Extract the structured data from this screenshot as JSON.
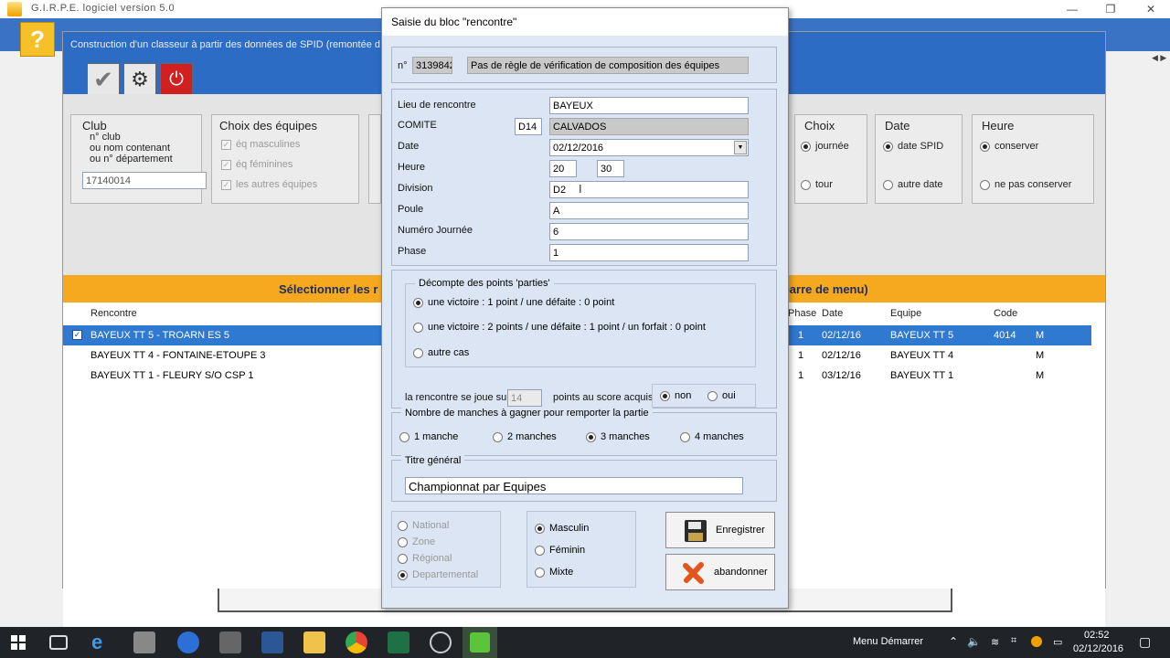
{
  "app": {
    "title": "G.I.R.P.E.  logiciel version  5.0",
    "min": "—",
    "max": "❐",
    "close": "✕",
    "help": "?"
  },
  "builder": {
    "title": "Construction d'un classeur à partir des données de SPID (remontée d",
    "toolbar": {
      "validate": "✔",
      "settings": "⚙",
      "power": "⏻"
    },
    "club": {
      "title": "Club",
      "desc1": "n° club",
      "desc2": "ou nom contenant",
      "desc3": "ou n° département",
      "value": "17140014"
    },
    "teams": {
      "title": "Choix des équipes",
      "items": [
        "éq masculines",
        "éq féminines",
        "les autres équipes"
      ]
    },
    "choix": {
      "title": "Choix",
      "opt1": "journée",
      "opt2": "tour"
    },
    "date": {
      "title": "Date",
      "opt1": "date SPID",
      "opt2": "autre date"
    },
    "heure": {
      "title": "Heure",
      "opt1": "conserver",
      "opt2": "ne pas conserver"
    },
    "orange_left": "Sélectionner les r",
    "orange_right": "a barre de menu)",
    "table": {
      "headers": {
        "rencontre": "Rencontre",
        "phase": "Phase",
        "date": "Date",
        "equipe": "Equipe",
        "code": "Code"
      },
      "rows": [
        {
          "rencontre": "BAYEUX TT 5   -   TROARN ES 5",
          "phase": "1",
          "date": "02/12/16",
          "equipe": "BAYEUX TT 5",
          "code": "4014",
          "sex": "M"
        },
        {
          "rencontre": "BAYEUX TT 4   -   FONTAINE-ETOUPE 3",
          "phase": "1",
          "date": "02/12/16",
          "equipe": "BAYEUX TT 4",
          "code": "",
          "sex": "M"
        },
        {
          "rencontre": "BAYEUX TT 1   -   FLEURY S/O CSP 1",
          "phase": "1",
          "date": "03/12/16",
          "equipe": "BAYEUX TT 1",
          "code": "",
          "sex": "M"
        }
      ]
    }
  },
  "dialog": {
    "title": "Saisie du bloc \"rencontre\"",
    "num_label": "n°",
    "num_value": "3139842",
    "rule_text": "Pas de règle de vérification de composition des équipes",
    "lieu_label": "Lieu de rencontre",
    "lieu_value": "BAYEUX",
    "comite_label": "COMITE",
    "comite_code": "D14",
    "comite_name": "CALVADOS",
    "date_label": "Date",
    "date_value": "02/12/2016",
    "heure_label": "Heure",
    "heure_h": "20",
    "heure_m": "30",
    "division_label": "Division",
    "division_value": "D2",
    "poule_label": "Poule",
    "poule_value": "A",
    "journee_label": "Numéro Journée",
    "journee_value": "6",
    "phase_label": "Phase",
    "phase_value": "1",
    "decompte": {
      "legend": "Décompte des points 'parties'",
      "opt1": "une victoire : 1 point / une défaite : 0 point",
      "opt2": "une victoire : 2 points / une défaite : 1 point / un forfait : 0 point",
      "opt3": "autre cas"
    },
    "score": {
      "pre": "la rencontre se joue sur",
      "value": "14",
      "post": "points au score acquis",
      "non": "non",
      "oui": "oui"
    },
    "manches": {
      "legend": "Nombre de manches à gagner pour remporter la partie",
      "m1": "1 manche",
      "m2": "2 manches",
      "m3": "3 manches",
      "m4": "4 manches"
    },
    "titre": {
      "legend": "Titre général",
      "value": "Championnat par Equipes"
    },
    "niveau": [
      "National",
      "Zone",
      "Régional",
      "Departemental"
    ],
    "sexe": [
      "Masculin",
      "Féminin",
      "Mixte"
    ],
    "enregistrer": "Enregistrer",
    "abandonner": "abandonner"
  },
  "taskbar": {
    "menu": "Menu Démarrer",
    "time": "02:52",
    "date": "02/12/2016"
  }
}
